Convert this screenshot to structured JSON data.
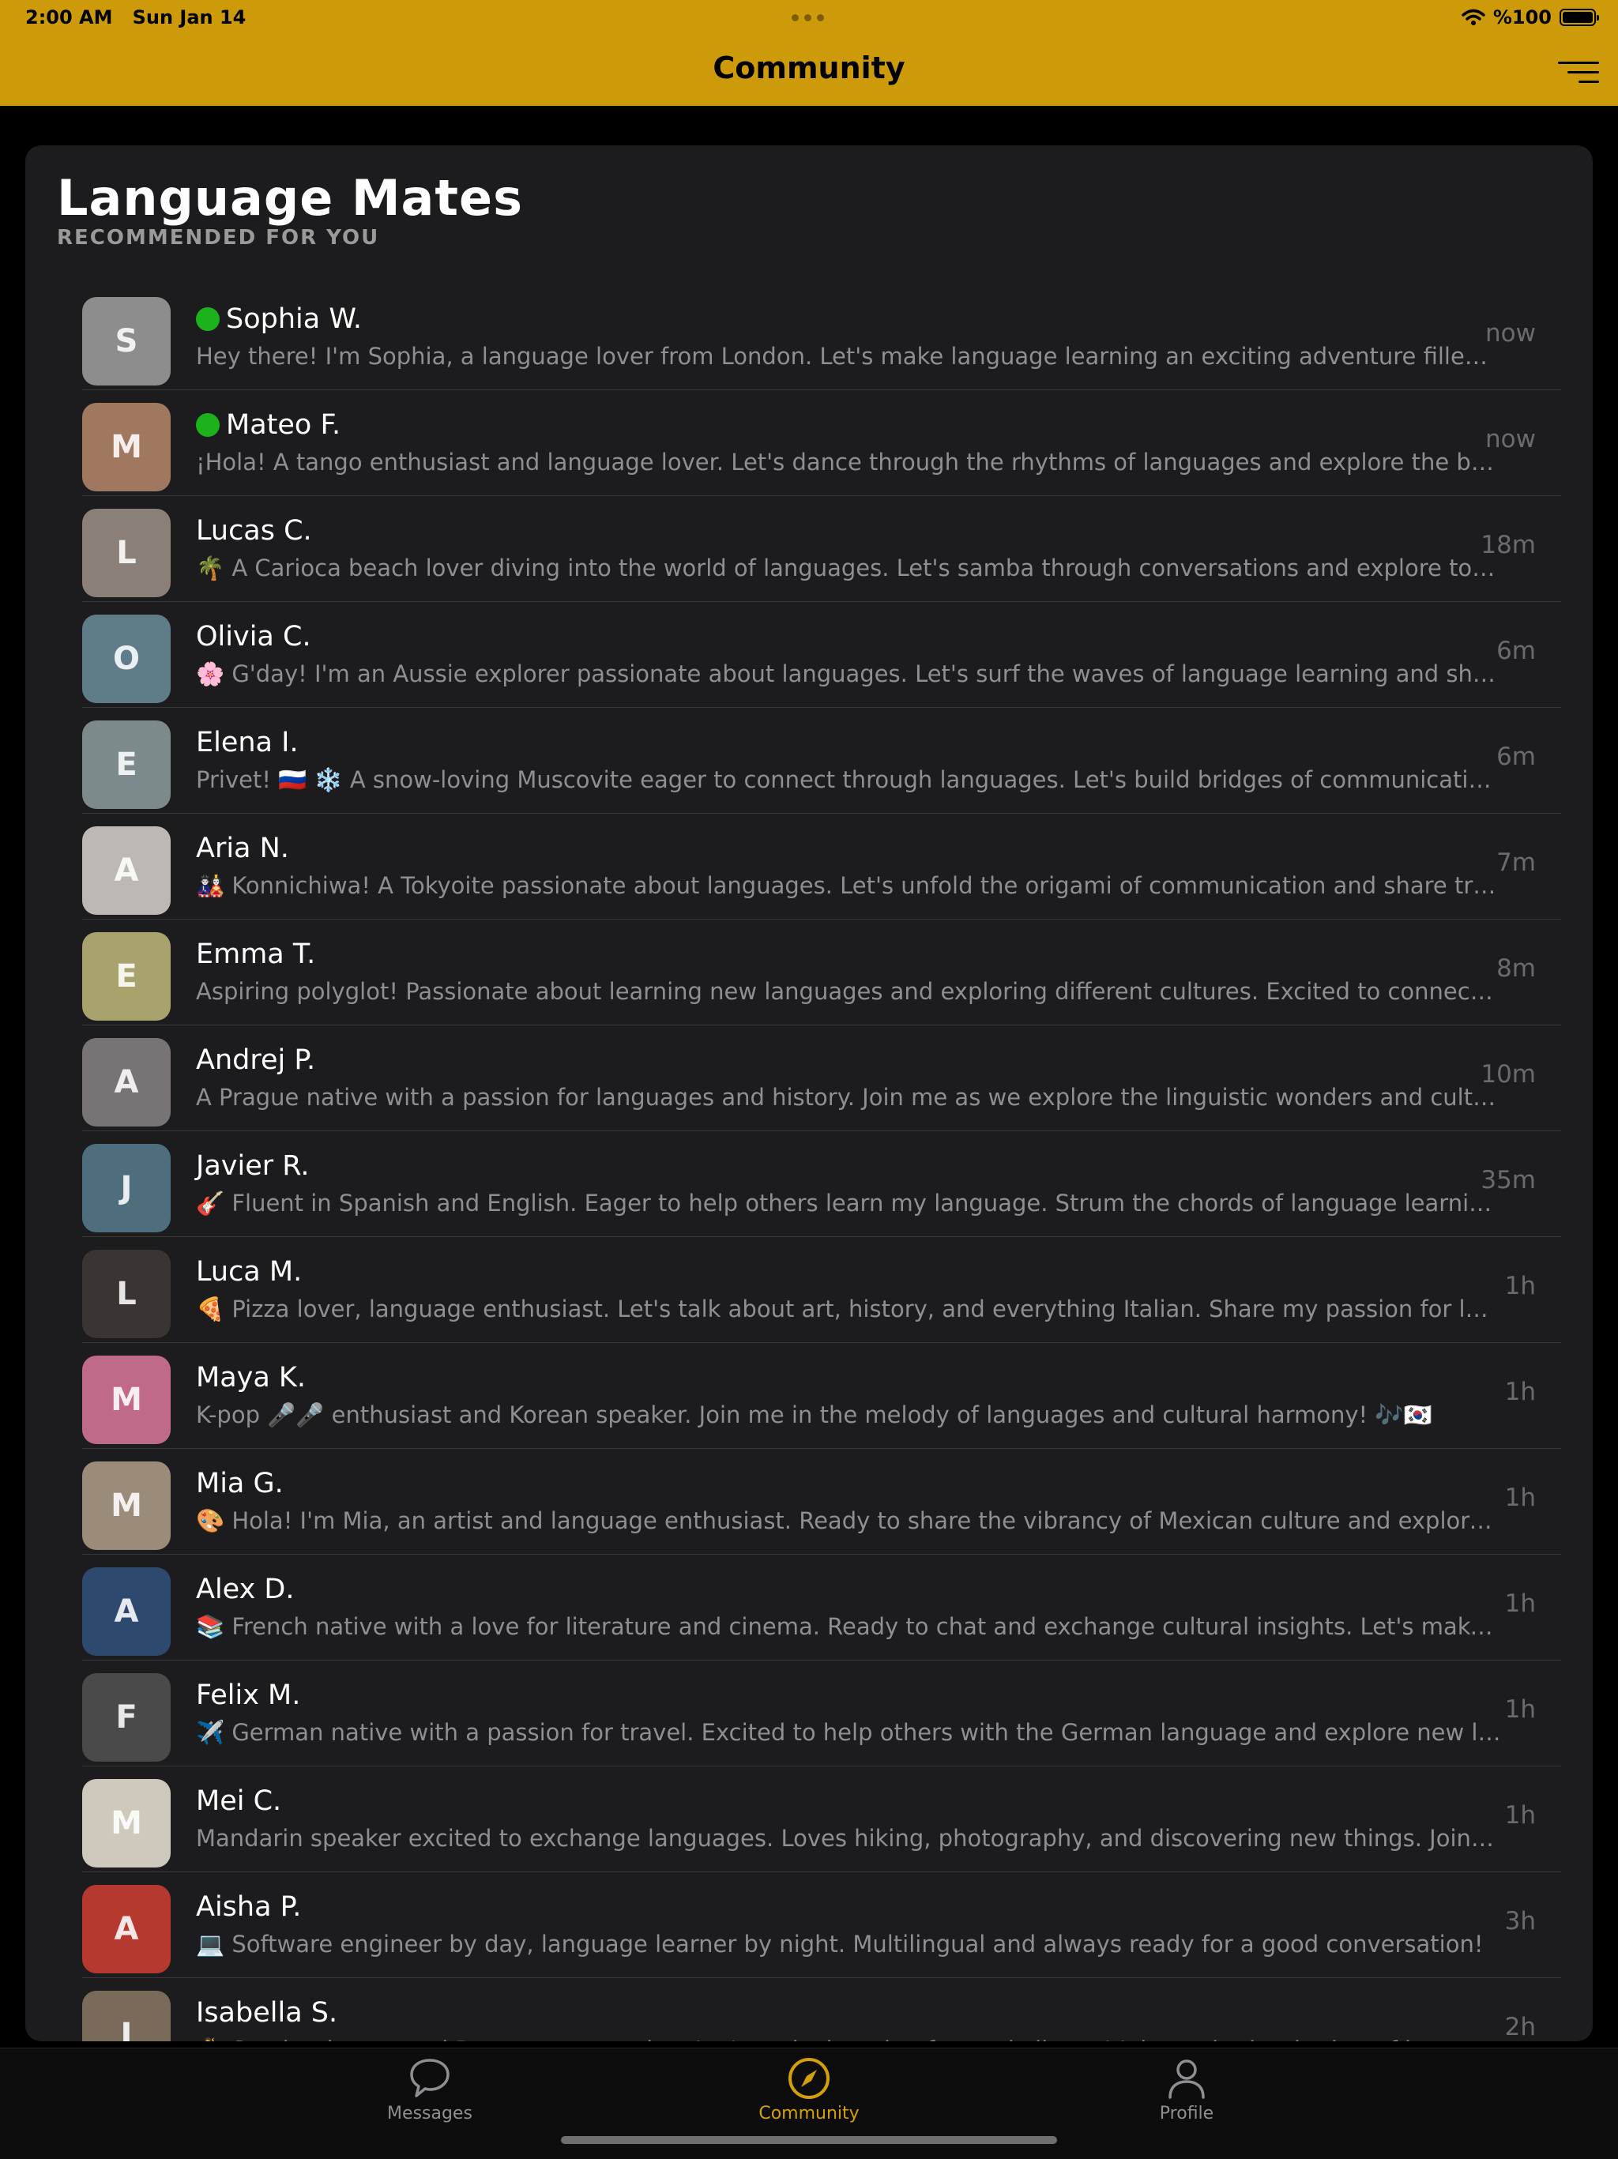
{
  "status_bar": {
    "time": "2:00 AM",
    "date": "Sun Jan 14",
    "battery": "%100",
    "wifi_icon": "wifi-icon"
  },
  "header": {
    "title": "Community",
    "filter_icon": "filter-icon"
  },
  "section": {
    "title": "Language Mates",
    "subtitle": "RECOMMENDED FOR YOU"
  },
  "users": [
    {
      "name": "Sophia W.",
      "online": true,
      "initial": "S",
      "avatar_color": "#8d8d8d",
      "bio": "Hey there! I'm Sophia, a language lover from London. Let's make language learning an exciting adventure filled with fun and friendship!",
      "time": "now"
    },
    {
      "name": "Mateo F.",
      "online": true,
      "initial": "M",
      "avatar_color": "#a07860",
      "bio": "¡Hola! A tango enthusiast and language lover. Let's dance through the rhythms of languages and explore the beauty of cultures together!",
      "time": "now"
    },
    {
      "name": "Lucas C.",
      "online": false,
      "initial": "L",
      "avatar_color": "#8a8078",
      "bio": "🌴 A Carioca beach lover diving into the world of languages. Let's samba through conversations and explore together!",
      "time": "18m"
    },
    {
      "name": "Olivia C.",
      "online": false,
      "initial": "O",
      "avatar_color": "#5f7d88",
      "bio": "🌸 G'day! I'm an Aussie explorer passionate about languages. Let's surf the waves of language learning and share stories!",
      "time": "6m"
    },
    {
      "name": "Elena I.",
      "online": false,
      "initial": "E",
      "avatar_color": "#7d8a8c",
      "bio": "Privet! 🇷🇺 ❄️ A snow-loving Muscovite eager to connect through languages. Let's build bridges of communication together!",
      "time": "6m"
    },
    {
      "name": "Aria N.",
      "online": false,
      "initial": "A",
      "avatar_color": "#bdb8b3",
      "bio": "🎎 Konnichiwa! A Tokyoite passionate about languages. Let's unfold the origami of communication and share traditions!",
      "time": "7m"
    },
    {
      "name": "Emma T.",
      "online": false,
      "initial": "E",
      "avatar_color": "#a8a26c",
      "bio": "Aspiring polyglot! Passionate about learning new languages and exploring different cultures. Excited to connect with you!",
      "time": "8m"
    },
    {
      "name": "Andrej P.",
      "online": false,
      "initial": "A",
      "avatar_color": "#787476",
      "bio": "A Prague native with a passion for languages and history. Join me as we explore the linguistic wonders and culture of Europe!",
      "time": "10m"
    },
    {
      "name": "Javier R.",
      "online": false,
      "initial": "J",
      "avatar_color": "#4e6e7e",
      "bio": "🎸 Fluent in Spanish and English. Eager to help others learn my language. Strum the chords of language learning with me!",
      "time": "35m"
    },
    {
      "name": "Luca M.",
      "online": false,
      "initial": "L",
      "avatar_color": "#3a3532",
      "bio": "🍕 Pizza lover, language enthusiast. Let's talk about art, history, and everything Italian. Share my passion for language!",
      "time": "1h"
    },
    {
      "name": "Maya K.",
      "online": false,
      "initial": "M",
      "avatar_color": "#c06a8a",
      "bio": "K-pop 🎤🎤 enthusiast and Korean speaker. Join me in the melody of languages and cultural harmony! 🎶🇰🇷",
      "time": "1h"
    },
    {
      "name": "Mia G.",
      "online": false,
      "initial": "M",
      "avatar_color": "#9a8c78",
      "bio": "🎨 Hola! I'm Mia, an artist and language enthusiast. Ready to share the vibrancy of Mexican culture and explore yours!",
      "time": "1h"
    },
    {
      "name": "Alex D.",
      "online": false,
      "initial": "A",
      "avatar_color": "#2d4a6e",
      "bio": "📚 French native with a love for literature and cinema. Ready to chat and exchange cultural insights. Let's make learning fun!",
      "time": "1h"
    },
    {
      "name": "Felix M.",
      "online": false,
      "initial": "F",
      "avatar_color": "#4a4a4a",
      "bio": "✈️ German native with a passion for travel. Excited to help others with the German language and explore new lands!",
      "time": "1h"
    },
    {
      "name": "Mei C.",
      "online": false,
      "initial": "M",
      "avatar_color": "#cfc8bd",
      "bio": "Mandarin speaker excited to exchange languages. Loves hiking, photography, and discovering new things. Join me!",
      "time": "1h"
    },
    {
      "name": "Aisha P.",
      "online": false,
      "initial": "A",
      "avatar_color": "#b5392e",
      "bio": "💻 Software engineer by day, language learner by night. Multilingual and always ready for a good conversation!",
      "time": "3h"
    },
    {
      "name": "Isabella S.",
      "online": false,
      "initial": "I",
      "avatar_color": "#7a6a5a",
      "bio": "💃 Samba dancer and Portuguese speaker. Let's make learning fun and vibrant! Join me in the rhythm of language!",
      "time": "2h"
    }
  ],
  "tabs": [
    {
      "label": "Messages",
      "icon": "chat-bubble-icon",
      "active": false
    },
    {
      "label": "Community",
      "icon": "compass-icon",
      "active": true
    },
    {
      "label": "Profile",
      "icon": "person-icon",
      "active": false
    }
  ],
  "colors": {
    "accent": "#cd9b0a",
    "card_background": "#1c1c1e",
    "online": "#1bb21b",
    "active_tab": "#d4a00a"
  }
}
